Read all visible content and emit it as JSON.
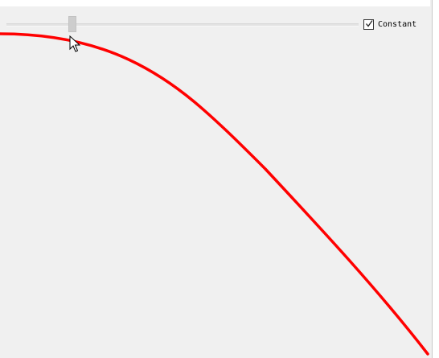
{
  "window": {
    "title": ""
  },
  "slider": {
    "value": 0.18
  },
  "constant_checkbox": {
    "label": "Constant",
    "checked": true
  },
  "curve": {
    "color": "#ff0000"
  },
  "icons": {
    "check": "check-icon",
    "cursor": "mouse-pointer-icon"
  }
}
